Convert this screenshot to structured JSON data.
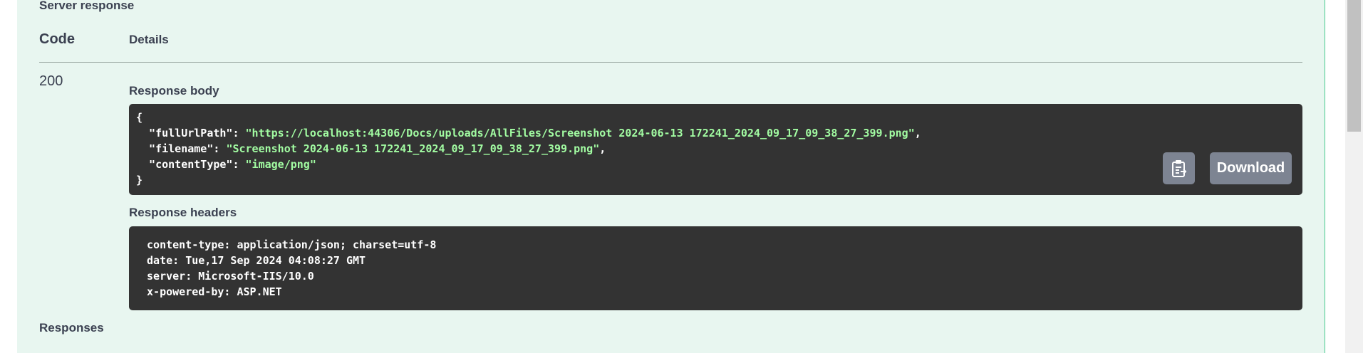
{
  "server_response": {
    "title": "Server response",
    "columns": {
      "code": "Code",
      "details": "Details"
    },
    "status_code": "200",
    "response_body": {
      "label": "Response body",
      "lines": [
        {
          "pre": "{",
          "str": "",
          "post": ""
        },
        {
          "pre": "  \"fullUrlPath\": ",
          "str": "\"https://localhost:44306/Docs/uploads/AllFiles/Screenshot 2024-06-13 172241_2024_09_17_09_38_27_399.png\"",
          "post": ","
        },
        {
          "pre": "  \"filename\": ",
          "str": "\"Screenshot 2024-06-13 172241_2024_09_17_09_38_27_399.png\"",
          "post": ","
        },
        {
          "pre": "  \"contentType\": ",
          "str": "\"image/png\"",
          "post": ""
        },
        {
          "pre": "}",
          "str": "",
          "post": ""
        }
      ],
      "copy_icon": "clipboard-copy-icon",
      "download_label": "Download"
    },
    "response_headers": {
      "label": "Response headers",
      "lines": [
        " content-type: application/json; charset=utf-8 ",
        " date: Tue,17 Sep 2024 04:08:27 GMT ",
        " server: Microsoft-IIS/10.0 ",
        " x-powered-by: ASP.NET "
      ]
    }
  },
  "responses": {
    "title": "Responses"
  },
  "colors": {
    "panel_bg": "#e8f6f0",
    "panel_border": "#49cc90",
    "code_bg": "#333333",
    "string_color": "#a2fca2",
    "button_bg": "#7d8492",
    "text": "#3b4151"
  }
}
